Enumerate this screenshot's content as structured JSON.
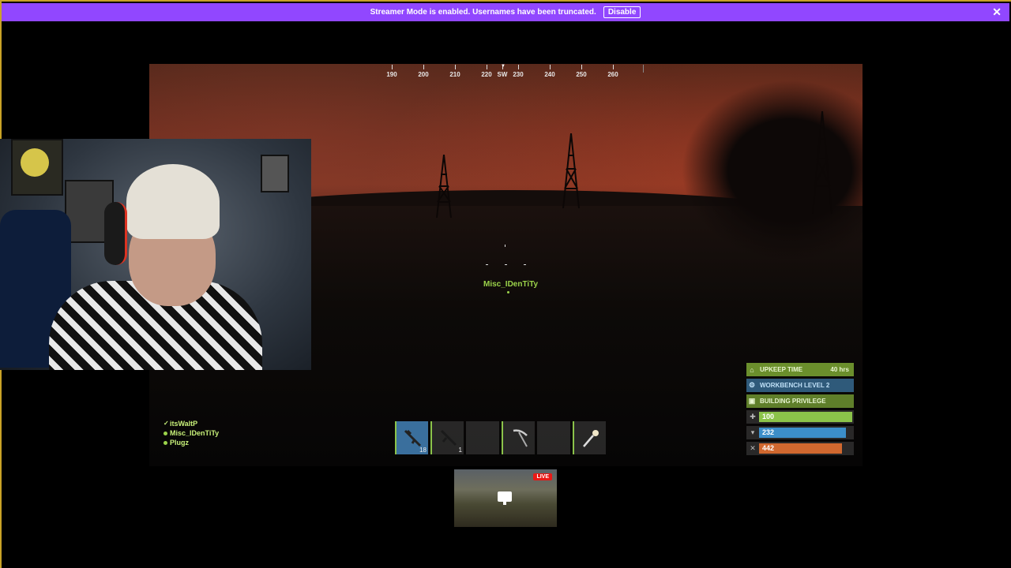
{
  "banner": {
    "message": "Streamer Mode is enabled. Usernames have been truncated.",
    "disable_label": "Disable",
    "close": "✕"
  },
  "compass": {
    "labels": [
      "190",
      "200",
      "210",
      "220",
      "SW",
      "230",
      "240",
      "250",
      "260"
    ]
  },
  "player_tag": "Misc_IDenTiTy",
  "team": [
    {
      "name": "itsWaltP",
      "marker": "check"
    },
    {
      "name": "Misc_IDenTiTy",
      "marker": "dot"
    },
    {
      "name": "Plugz",
      "marker": "dot"
    }
  ],
  "hotbar": {
    "slots": [
      {
        "item": "rifle-icon",
        "count": "18",
        "active": true
      },
      {
        "item": "rifle-icon",
        "count": "1",
        "active": false
      },
      {
        "item": "",
        "count": "",
        "active": false
      },
      {
        "item": "pickaxe-icon",
        "count": "",
        "active": false
      },
      {
        "item": "",
        "count": "",
        "active": false
      },
      {
        "item": "torch-icon",
        "count": "",
        "active": false
      }
    ]
  },
  "pip": {
    "live_label": "LIVE"
  },
  "status": {
    "upkeep_label": "UPKEEP TIME",
    "upkeep_value": "40 hrs",
    "workbench_label": "WORKBENCH LEVEL 2",
    "privilege_label": "BUILDING PRIVILEGE",
    "health": "100",
    "water": "232",
    "food": "442",
    "health_level": 1.0,
    "water_level": 0.93,
    "food_level": 0.89,
    "colors": {
      "upkeep": "#6b8f2c",
      "workbench": "#2f5a7a",
      "privilege": "#5f7f2a",
      "health": "#8bc34a",
      "water": "#3c8ec9",
      "food": "#d0682f"
    }
  }
}
